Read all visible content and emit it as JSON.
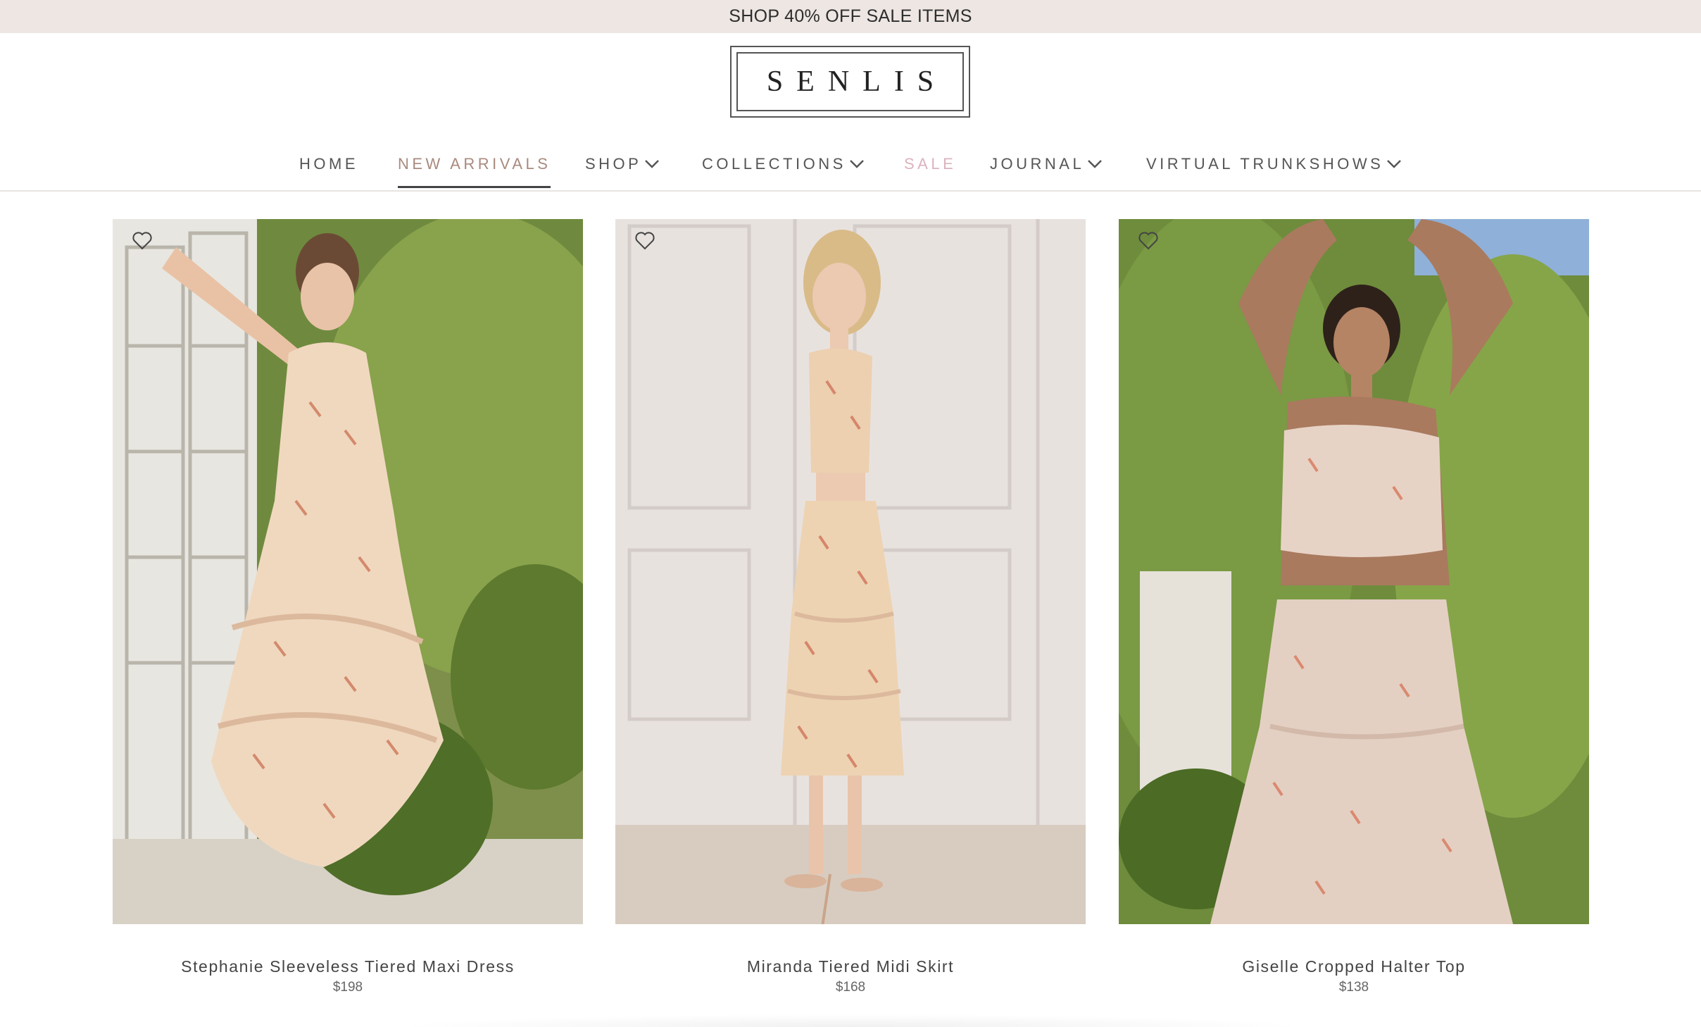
{
  "promo": {
    "text": "SHOP 40% OFF SALE ITEMS"
  },
  "brand": {
    "logo_text": "SENLIS"
  },
  "nav": {
    "items": [
      {
        "label": "HOME",
        "has_dropdown": false,
        "state": "default"
      },
      {
        "label": "NEW ARRIVALS",
        "has_dropdown": false,
        "state": "active"
      },
      {
        "label": "SHOP",
        "has_dropdown": true,
        "state": "default"
      },
      {
        "label": "COLLECTIONS",
        "has_dropdown": true,
        "state": "default"
      },
      {
        "label": "SALE",
        "has_dropdown": false,
        "state": "sale"
      },
      {
        "label": "JOURNAL",
        "has_dropdown": true,
        "state": "default"
      },
      {
        "label": "VIRTUAL TRUNKSHOWS",
        "has_dropdown": true,
        "state": "default"
      }
    ]
  },
  "colors": {
    "promo_bg": "#ede6e3",
    "active_nav": "#a98a7e",
    "sale_nav": "#dcb3bd",
    "text": "#444444"
  },
  "products": [
    {
      "name": "Stephanie Sleeveless Tiered Maxi Dress",
      "price": "$198",
      "wishlist_icon": "heart-outline-icon"
    },
    {
      "name": "Miranda Tiered Midi Skirt",
      "price": "$168",
      "wishlist_icon": "heart-outline-icon"
    },
    {
      "name": "Giselle Cropped Halter Top",
      "price": "$138",
      "wishlist_icon": "heart-outline-icon"
    }
  ]
}
